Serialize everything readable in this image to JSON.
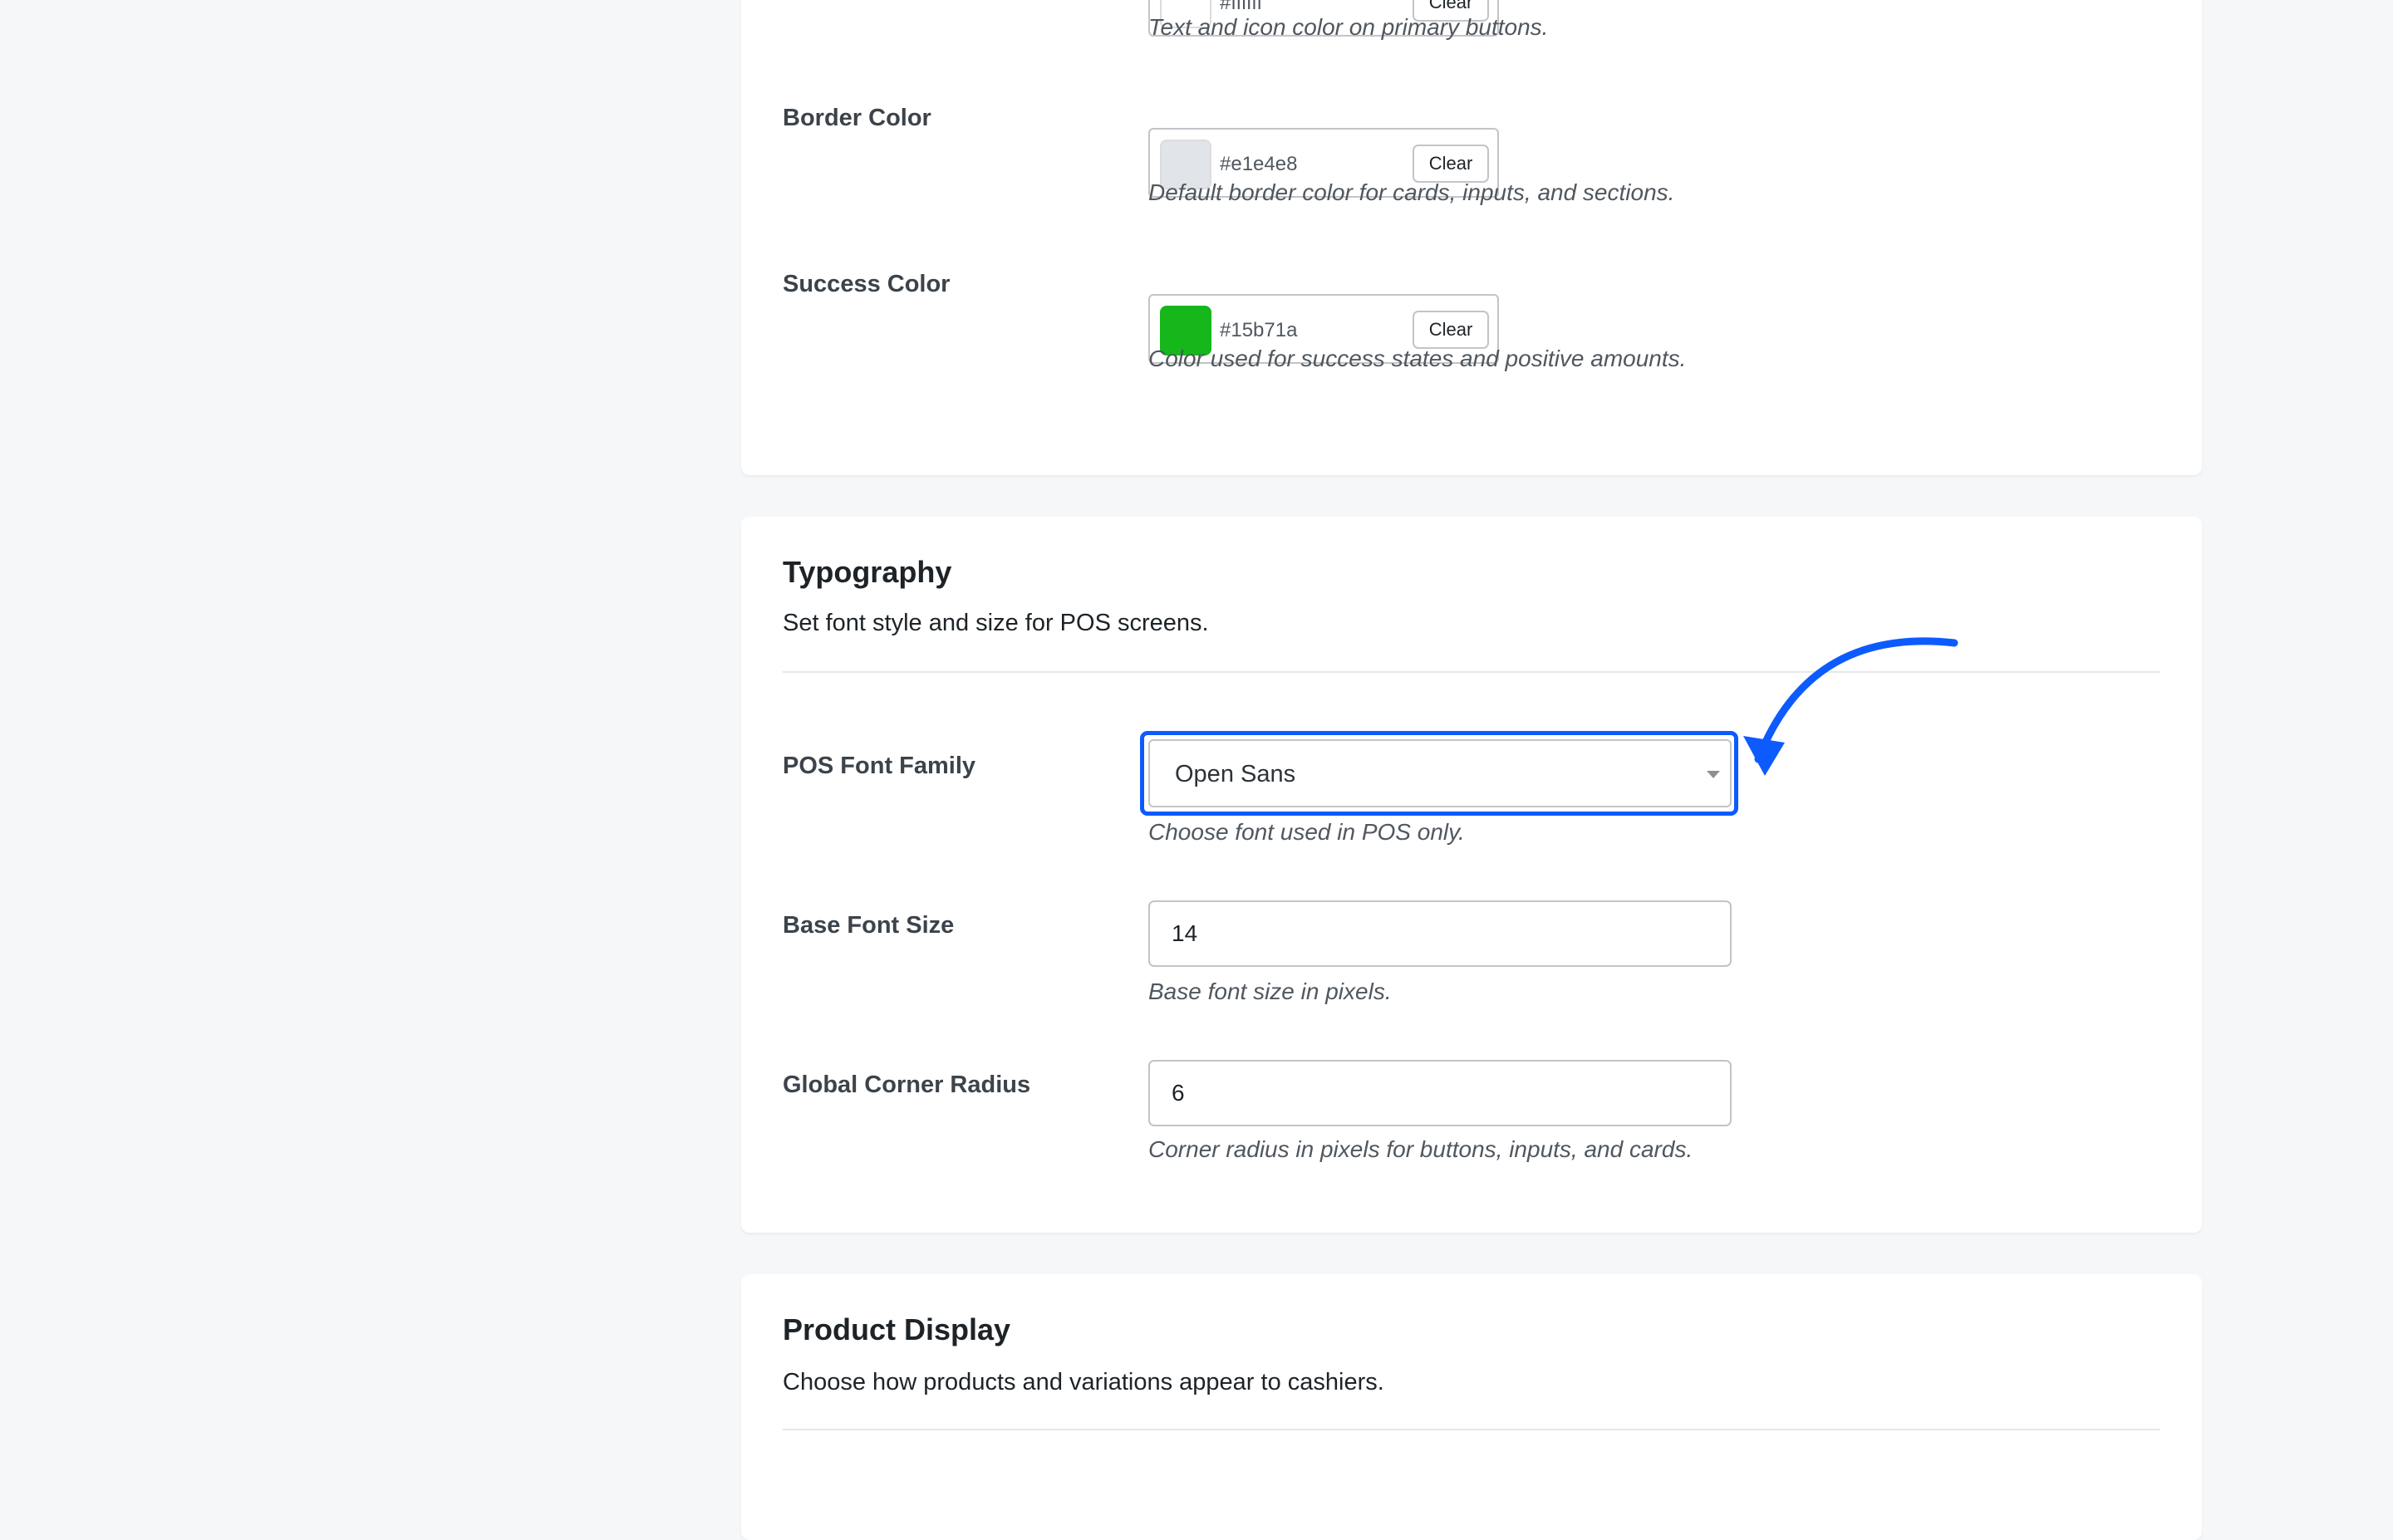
{
  "colors_section": {
    "rows": [
      {
        "label": "",
        "hex": "#ffffff",
        "hex_display": "#ffffff",
        "clear_label": "Clear",
        "description": "Text and icon color on primary buttons."
      },
      {
        "label": "Border Color",
        "hex": "#e1e4e8",
        "hex_display": "#e1e4e8",
        "clear_label": "Clear",
        "description": "Default border color for cards, inputs, and sections."
      },
      {
        "label": "Success Color",
        "hex": "#15b71a",
        "hex_display": "#15b71a",
        "clear_label": "Clear",
        "description": "Color used for success states and positive amounts."
      }
    ]
  },
  "typography": {
    "title": "Typography",
    "subtitle": "Set font style and size for POS screens.",
    "font_family": {
      "label": "POS Font Family",
      "value": "Open Sans",
      "description": "Choose font used in POS only."
    },
    "base_font_size": {
      "label": "Base Font Size",
      "value": "14",
      "description": "Base font size in pixels."
    },
    "corner_radius": {
      "label": "Global Corner Radius",
      "value": "6",
      "description": "Corner radius in pixels for buttons, inputs, and cards."
    }
  },
  "product_display": {
    "title": "Product Display",
    "subtitle": "Choose how products and variations appear to cashiers."
  },
  "annotation": {
    "color": "#0d5bff"
  }
}
